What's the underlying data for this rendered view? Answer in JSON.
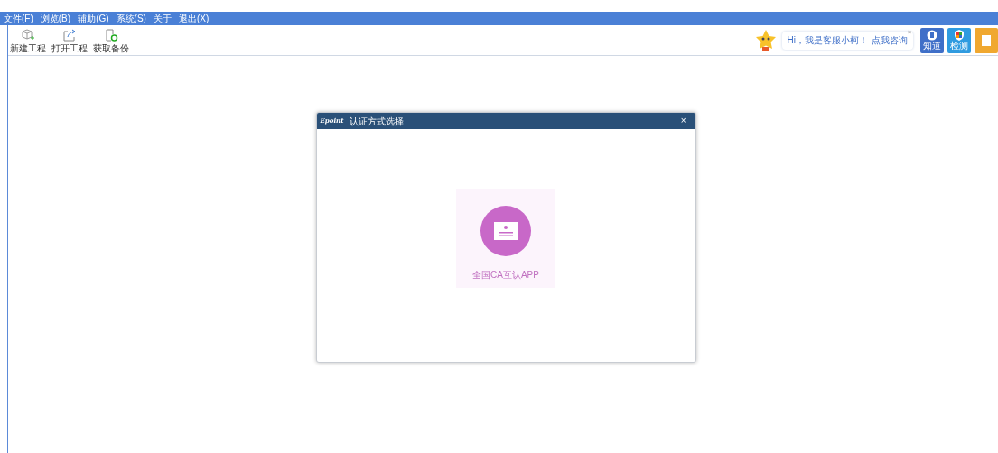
{
  "menu": [
    "文件(F)",
    "浏览(B)",
    "辅助(G)",
    "系统(S)",
    "关于",
    "退出(X)"
  ],
  "toolbar": [
    {
      "kind": "new",
      "label": "新建工程"
    },
    {
      "kind": "open",
      "label": "打开工程"
    },
    {
      "kind": "backup",
      "label": "获取备份"
    }
  ],
  "assistant": {
    "greeting": "Hi，我是客服小柯！",
    "link": "点我咨询",
    "close": "×"
  },
  "quick_buttons": [
    {
      "kind": "know",
      "label": "知道",
      "color": "#3f6fc8"
    },
    {
      "kind": "check",
      "label": "检测",
      "color": "#2f9be0"
    },
    {
      "kind": "hand",
      "color": "#f0a830"
    }
  ],
  "dialog": {
    "logo": "Epoint",
    "title": "认证方式选择",
    "close": "×",
    "options": [
      {
        "label": "全国CA互认APP"
      }
    ]
  }
}
